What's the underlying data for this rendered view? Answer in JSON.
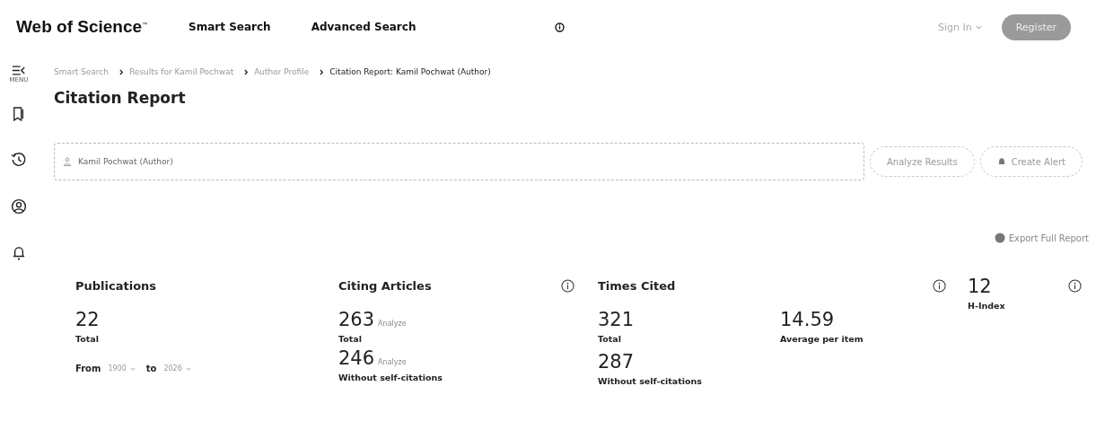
{
  "header": {
    "logo": "Web of Science",
    "trademark": "™",
    "nav": [
      {
        "label": "Smart Search"
      },
      {
        "label": "Advanced Search"
      }
    ],
    "sign_in": "Sign In",
    "register": "Register"
  },
  "sidebar": {
    "menu_label": "MENU"
  },
  "breadcrumb": [
    {
      "label": "Smart Search",
      "current": false
    },
    {
      "label": "Results for Kamil Pochwat",
      "current": false
    },
    {
      "label": "Author Profile",
      "current": false
    },
    {
      "label": "Citation Report: Kamil Pochwat (Author)",
      "current": true
    }
  ],
  "title": "Citation Report",
  "query": {
    "value": "Kamil Pochwat (Author)"
  },
  "actions": [
    "Analyze Results",
    "Create Alert"
  ],
  "export": "Export Full Report",
  "publications": {
    "title": "Publications",
    "value": "22",
    "label": "Total",
    "from_label": "From",
    "from": "1900",
    "to_label": "to",
    "to": "2026"
  },
  "citing_articles": {
    "title": "Citing Articles",
    "items": [
      {
        "value": "263",
        "link": "Analyze",
        "label": "Total"
      },
      {
        "value": "246",
        "link": "Analyze",
        "label": "Without self-citations"
      }
    ]
  },
  "times_cited": {
    "title": "Times Cited",
    "items": [
      {
        "value": "321",
        "label": "Total"
      },
      {
        "value": "14.59",
        "label": "Average per item"
      },
      {
        "value": "287",
        "label": "Without self-citations"
      }
    ]
  },
  "h_index": {
    "value": "12",
    "label": "H-Index"
  }
}
